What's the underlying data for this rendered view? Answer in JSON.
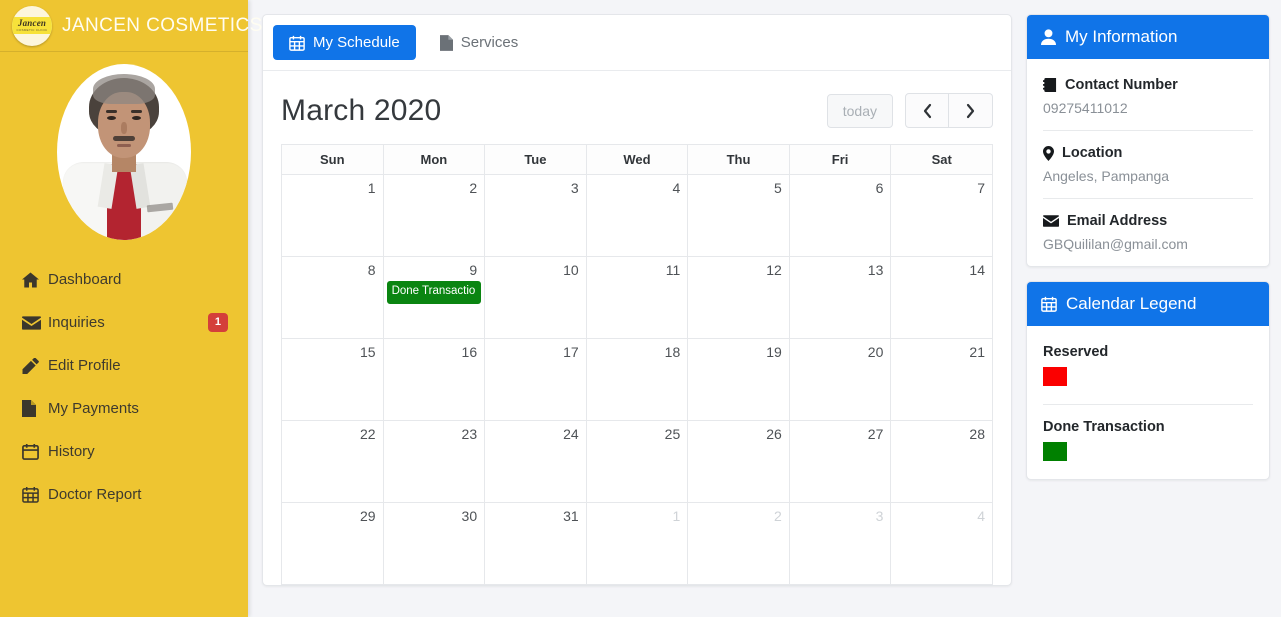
{
  "brand": {
    "name": "JANCEN COSMETICS",
    "logo_icon": "jancen-circle-logo",
    "logo_text": "Jancen",
    "logo_subtext": "COSMETIC CLINIC"
  },
  "avatar": {
    "icon": "doctor-portrait-avatar"
  },
  "sidebar": {
    "items": [
      {
        "label": "Dashboard",
        "icon": "home-icon",
        "badge": null
      },
      {
        "label": "Inquiries",
        "icon": "envelope-icon",
        "badge": "1"
      },
      {
        "label": "Edit Profile",
        "icon": "pencil-icon",
        "badge": null
      },
      {
        "label": "My Payments",
        "icon": "file-icon",
        "badge": null
      },
      {
        "label": "History",
        "icon": "calendar-icon",
        "badge": null
      },
      {
        "label": "Doctor Report",
        "icon": "calendar-grid-icon",
        "badge": null
      }
    ]
  },
  "tabs": [
    {
      "label": "My Schedule",
      "icon": "calendar-icon",
      "active": true
    },
    {
      "label": "Services",
      "icon": "file-icon",
      "active": false
    }
  ],
  "calendar": {
    "title": "March 2020",
    "today_button": "today",
    "prev_icon": "chevron-left-icon",
    "next_icon": "chevron-right-icon",
    "weekdays": [
      "Sun",
      "Mon",
      "Tue",
      "Wed",
      "Thu",
      "Fri",
      "Sat"
    ],
    "today_date": 17,
    "weeks": [
      [
        {
          "day": "1",
          "other": false
        },
        {
          "day": "2",
          "other": false
        },
        {
          "day": "3",
          "other": false
        },
        {
          "day": "4",
          "other": false
        },
        {
          "day": "5",
          "other": false
        },
        {
          "day": "6",
          "other": false
        },
        {
          "day": "7",
          "other": false
        }
      ],
      [
        {
          "day": "8",
          "other": false
        },
        {
          "day": "9",
          "other": false,
          "event": {
            "label": "Done Transactio",
            "color": "#0a8511"
          }
        },
        {
          "day": "10",
          "other": false
        },
        {
          "day": "11",
          "other": false
        },
        {
          "day": "12",
          "other": false
        },
        {
          "day": "13",
          "other": false
        },
        {
          "day": "14",
          "other": false
        }
      ],
      [
        {
          "day": "15",
          "other": false
        },
        {
          "day": "16",
          "other": false
        },
        {
          "day": "17",
          "other": false,
          "today": true
        },
        {
          "day": "18",
          "other": false
        },
        {
          "day": "19",
          "other": false
        },
        {
          "day": "20",
          "other": false
        },
        {
          "day": "21",
          "other": false
        }
      ],
      [
        {
          "day": "22",
          "other": false
        },
        {
          "day": "23",
          "other": false
        },
        {
          "day": "24",
          "other": false
        },
        {
          "day": "25",
          "other": false
        },
        {
          "day": "26",
          "other": false
        },
        {
          "day": "27",
          "other": false
        },
        {
          "day": "28",
          "other": false
        }
      ],
      [
        {
          "day": "29",
          "other": false
        },
        {
          "day": "30",
          "other": false
        },
        {
          "day": "31",
          "other": false
        },
        {
          "day": "1",
          "other": true
        },
        {
          "day": "2",
          "other": true
        },
        {
          "day": "3",
          "other": true
        },
        {
          "day": "4",
          "other": true
        }
      ]
    ]
  },
  "my_information": {
    "title": "My Information",
    "title_icon": "user-icon",
    "rows": [
      {
        "label": "Contact Number",
        "icon": "address-book-icon",
        "value": "09275411012"
      },
      {
        "label": "Location",
        "icon": "map-marker-icon",
        "value": "Angeles, Pampanga"
      },
      {
        "label": "Email Address",
        "icon": "envelope-icon",
        "value": "GBQuililan@gmail.com"
      }
    ]
  },
  "calendar_legend": {
    "title": "Calendar Legend",
    "title_icon": "calendar-grid-icon",
    "items": [
      {
        "label": "Reserved",
        "color": "#fb0000"
      },
      {
        "label": "Done Transaction",
        "color": "#008000"
      }
    ]
  },
  "colors": {
    "sidebar": "#eec531",
    "accent_blue": "#1074e8",
    "badge_red": "#d43f3a",
    "today_highlight": "#fcf8e3",
    "page_background": "#f4f5f8"
  }
}
